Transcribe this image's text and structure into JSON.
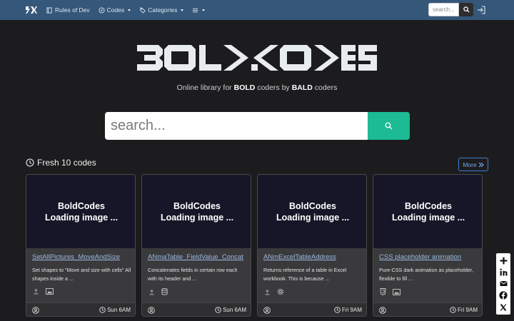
{
  "nav": {
    "items": [
      {
        "label": "Rules of Dev",
        "icon": "book-icon",
        "dropdown": false
      },
      {
        "label": "Codes",
        "icon": "compass-icon",
        "dropdown": true
      },
      {
        "label": "Categories",
        "icon": "tags-icon",
        "dropdown": true
      }
    ],
    "more_icon": "hamburger-icon",
    "search_placeholder": "search...",
    "login_icon": "sign-in-icon"
  },
  "hero": {
    "logo_text": "BOLD.CODES",
    "tagline_prefix": "Online library for ",
    "tagline_bold1": "BOLD",
    "tagline_mid": " coders by ",
    "tagline_bold2": "BALD",
    "tagline_suffix": " coders",
    "search_placeholder": "search..."
  },
  "section": {
    "title": "Fresh 10 codes",
    "more_label": "More"
  },
  "cards": [
    {
      "image_line1": "BoldCodes",
      "image_line2": "Loading image ...",
      "title": "SetAllPictures_MoveAndSize",
      "desc": "Set shapes to \"Move and size with cells\" All shapes inside a ...",
      "icons": [
        "user-icon",
        "image-icon"
      ],
      "time": "Sun 6AM"
    },
    {
      "image_line1": "BoldCodes",
      "image_line2": "Loading image ...",
      "title": "ANmaTable_FieldValue_Concat",
      "desc": "Concatenates fields in certain row each with its header and ...",
      "icons": [
        "user-icon",
        "database-icon"
      ],
      "time": "Sun 6AM"
    },
    {
      "image_line1": "BoldCodes",
      "image_line2": "Loading image ...",
      "title": "ANmExcelTableAddress",
      "desc": "Returns reference of a table in Excel workbook. This is because ...",
      "icons": [
        "user-icon",
        "gear-icon"
      ],
      "time": "Fri 9AM"
    },
    {
      "image_line1": "BoldCodes",
      "image_line2": "Loading image ...",
      "title": "CSS placeholder animation",
      "desc": "Pure-CSS dark animation as placeholder, flexible to fill ...",
      "icons": [
        "css3-icon",
        "image-icon"
      ],
      "time": "Fri 9AM"
    }
  ],
  "share": [
    "plus-icon",
    "linkedin-icon",
    "email-icon",
    "facebook-icon",
    "x-icon"
  ],
  "colors": {
    "navbar": "#34577a",
    "accent": "#1cbb93",
    "background": "#1c1c1e",
    "card": "#3a3a3c",
    "card_image": "#161628",
    "link": "#9bb9e0"
  }
}
